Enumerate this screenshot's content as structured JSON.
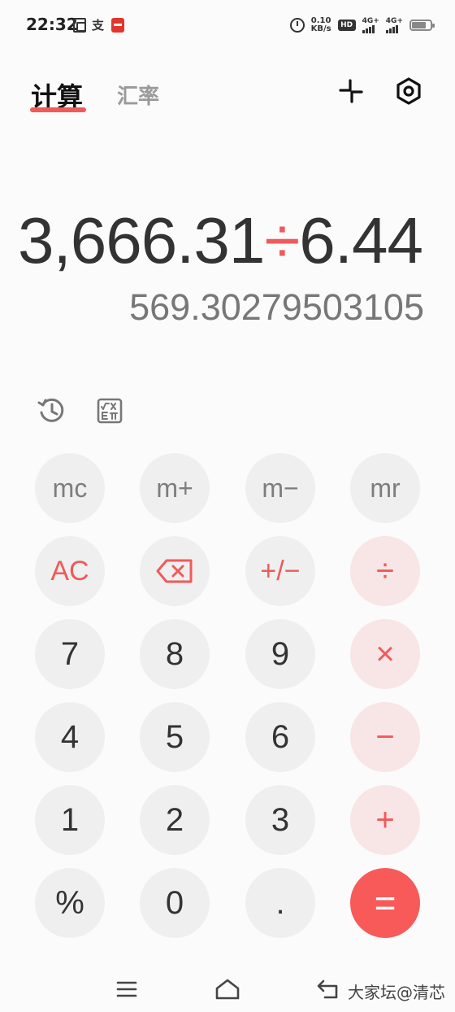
{
  "status_bar": {
    "time": "22:32",
    "notification_text": "支",
    "net_speed_value": "0.10",
    "net_speed_unit": "KB/s",
    "hd_label": "HD",
    "signal_1": "4G+",
    "signal_2": "4G+"
  },
  "header": {
    "tabs": [
      {
        "label": "计算",
        "active": true
      },
      {
        "label": "汇率",
        "active": false
      }
    ]
  },
  "display": {
    "operand1": "3,666.31",
    "operator": "÷",
    "operand2": "6.44",
    "result": "569.30279503105"
  },
  "keypad": {
    "rows": [
      [
        "mc",
        "m+",
        "m−",
        "mr"
      ],
      [
        "AC",
        "⌫",
        "+/−",
        "÷"
      ],
      [
        "7",
        "8",
        "9",
        "×"
      ],
      [
        "4",
        "5",
        "6",
        "−"
      ],
      [
        "1",
        "2",
        "3",
        "+"
      ],
      [
        "%",
        "0",
        ".",
        "="
      ]
    ]
  },
  "watermark": "大家坛@清芯",
  "colors": {
    "accent": "#f05a5a",
    "key_bg": "#efefef",
    "op_key_bg": "#f8e5e5",
    "equals_bg": "#f85a5a",
    "background": "#fbfbfb"
  },
  "icons": {
    "shrink": "shrink-icon",
    "settings": "settings-icon",
    "history": "history-icon",
    "scientific": "scientific-icon",
    "backspace": "backspace-icon"
  }
}
